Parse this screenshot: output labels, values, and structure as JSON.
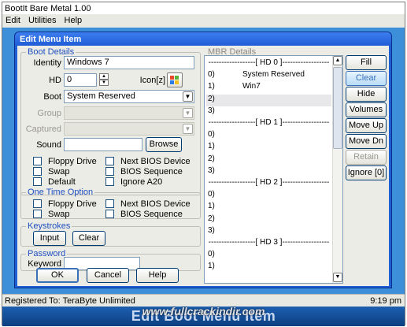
{
  "app": {
    "title": "BootIt Bare Metal 1.00",
    "menu": [
      "Edit",
      "Utilities",
      "Help"
    ],
    "status_left": "Registered To: TeraByte Unlimited",
    "status_right": "9:19 pm",
    "banner": "Edit Boot Menu Item",
    "watermark": "www.fullcrackindir.com"
  },
  "dialog": {
    "title": "Edit Menu Item",
    "boot_details": {
      "legend": "Boot Details",
      "identity_label": "Identity",
      "identity_value": "Windows 7",
      "hd_label": "HD",
      "hd_value": "0",
      "icon_label": "Icon[z]",
      "boot_label": "Boot",
      "boot_value": "System Reserved",
      "group_label": "Group",
      "group_value": "",
      "captured_label": "Captured",
      "captured_value": "",
      "sound_label": "Sound",
      "sound_value": "",
      "browse_label": "Browse",
      "options": [
        "Floppy Drive",
        "Next BIOS Device",
        "Swap",
        "BIOS Sequence",
        "Default",
        "Ignore A20"
      ]
    },
    "one_time": {
      "legend": "One Time Option",
      "options": [
        "Floppy Drive",
        "Next BIOS Device",
        "Swap",
        "BIOS Sequence"
      ]
    },
    "keystrokes": {
      "legend": "Keystrokes",
      "input_label": "Input",
      "clear_label": "Clear"
    },
    "password": {
      "legend": "Password",
      "keyword_label": "Keyword",
      "keyword_value": ""
    },
    "buttons": {
      "ok": "OK",
      "cancel": "Cancel",
      "help": "Help"
    },
    "mbr": {
      "legend": "MBR Details",
      "rows": [
        {
          "text": "------------------[ HD 0 ]------------------",
          "type": "hdr"
        },
        {
          "num": "0)",
          "name": "System Reserved",
          "type": "item"
        },
        {
          "num": "1)",
          "name": "Win7",
          "type": "item"
        },
        {
          "num": "2)",
          "name": "",
          "type": "item",
          "selected": true
        },
        {
          "num": "3)",
          "name": "",
          "type": "item"
        },
        {
          "text": "------------------[ HD 1 ]------------------",
          "type": "hdr"
        },
        {
          "num": "0)",
          "name": "",
          "type": "item"
        },
        {
          "num": "1)",
          "name": "",
          "type": "item"
        },
        {
          "num": "2)",
          "name": "",
          "type": "item"
        },
        {
          "num": "3)",
          "name": "",
          "type": "item"
        },
        {
          "text": "------------------[ HD 2 ]------------------",
          "type": "hdr"
        },
        {
          "num": "0)",
          "name": "",
          "type": "item"
        },
        {
          "num": "1)",
          "name": "",
          "type": "item"
        },
        {
          "num": "2)",
          "name": "",
          "type": "item"
        },
        {
          "num": "3)",
          "name": "",
          "type": "item"
        },
        {
          "text": "------------------[ HD 3 ]------------------",
          "type": "hdr"
        },
        {
          "num": "0)",
          "name": "",
          "type": "item"
        },
        {
          "num": "1)",
          "name": "",
          "type": "item"
        }
      ]
    },
    "side_buttons": [
      {
        "label": "Fill",
        "state": "normal"
      },
      {
        "label": "Clear",
        "state": "hover"
      },
      {
        "label": "Hide",
        "state": "normal"
      },
      {
        "label": "Volumes",
        "state": "normal"
      },
      {
        "label": "Move Up",
        "state": "normal"
      },
      {
        "label": "Move Dn",
        "state": "normal"
      },
      {
        "label": "Retain",
        "state": "disabled"
      },
      {
        "label": "Ignore [0]",
        "state": "normal"
      }
    ]
  }
}
